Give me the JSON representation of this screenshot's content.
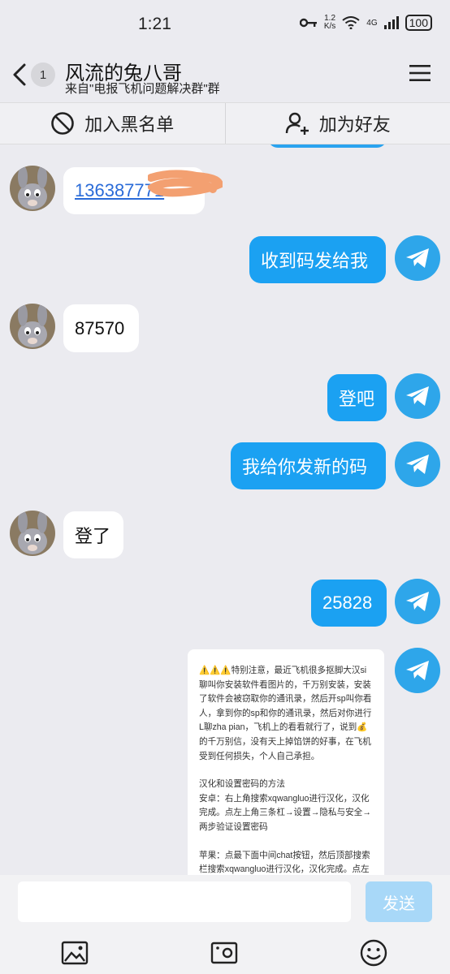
{
  "status": {
    "time": "1:21",
    "net_speed_value": "1.2",
    "net_speed_unit": "K/s",
    "network": "4G",
    "battery": "100"
  },
  "header": {
    "unread_count": "1",
    "title": "风流的兔八哥",
    "subtitle": "来自\"电报飞机问题解决群\"群"
  },
  "actions": {
    "blacklist_label": "加入黑名单",
    "add_friend_label": "加为好友"
  },
  "messages": {
    "m1": "136387771",
    "m2": "收到码发给我",
    "m3": "87570",
    "m4": "登吧",
    "m5": "我给你发新的码",
    "m6": "登了",
    "m7": "25828"
  },
  "notice": {
    "line1": "⚠️⚠️⚠️特别注意，最近飞机很多抠脚大汉si聊叫你安装软件看图片的，千万别安装，安装了软件会被窃取你的通讯录，然后开sp叫你看人，拿到你的sp和你的通讯录，然后对你进行L聊zha pian，飞机上的看看就行了，说到💰的千万别信，没有天上掉馅饼的好事，在飞机受到任何损失，个人自己承担。",
    "line2": "汉化和设置密码的方法\n安卓：右上角搜索xqwangluo进行汉化，汉化完成。点左上角三条杠→设置→隐私与安全→两步验证设置密码",
    "line3": "苹果：点最下面中间chat按钮，然后顶部搜索栏搜索xqwangluo进行汉化，汉化完成。点左下角设置→隐私与安全→两步验证设置密码"
  },
  "composer": {
    "placeholder": "",
    "send_label": "发送"
  },
  "colors": {
    "accent": "#1ba1f2",
    "send_disabled": "#a8d8f8",
    "background": "#ebebf0"
  }
}
